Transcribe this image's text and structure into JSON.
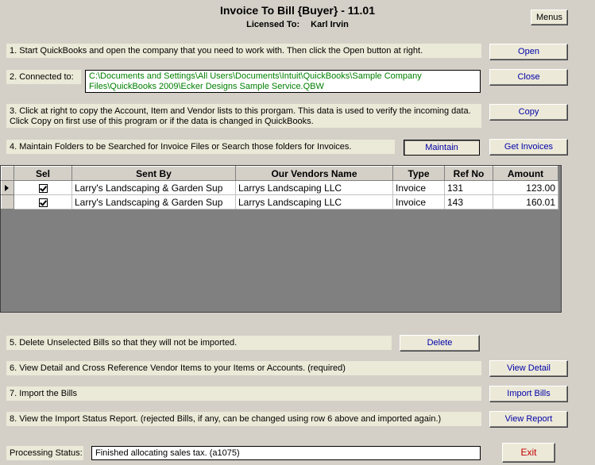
{
  "header": {
    "title": "Invoice To Bill {Buyer} - 11.01",
    "licensed_label": "Licensed To:",
    "licensed_name": "Karl Irvin"
  },
  "buttons": {
    "menus": "Menus",
    "open": "Open",
    "close": "Close",
    "copy": "Copy",
    "maintain": "Maintain",
    "get_invoices": "Get Invoices",
    "delete": "Delete",
    "view_detail": "View Detail",
    "import_bills": "Import Bills",
    "view_report": "View Report",
    "exit": "Exit"
  },
  "steps": {
    "s1": "1. Start QuickBooks and open the company that you need to work with. Then click the Open button at right.",
    "s2": "2. Connected to:",
    "s2_path": "C:\\Documents and Settings\\All Users\\Documents\\Intuit\\QuickBooks\\Sample Company Files\\QuickBooks 2009\\Ecker Designs Sample Service.QBW",
    "s3": "3. Click at right to copy the Account, Item and Vendor lists to this prorgam. This data is used to verify the incoming data. Click Copy on first use of this program or if the data is changed in QuickBooks.",
    "s4": "4. Maintain Folders to be Searched for Invoice Files or Search those folders for Invoices.",
    "s5": "5. Delete Unselected Bills so that they will not be imported.",
    "s6": "6. View Detail and Cross Reference Vendor Items to your Items or Accounts. (required)",
    "s7": "7. Import the Bills",
    "s8": "8. View the Import Status Report.  (rejected Bills, if any, can be changed using row 6 above and imported again.)"
  },
  "grid": {
    "columns": [
      "Sel",
      "Sent By",
      "Our Vendors Name",
      "Type",
      "Ref No",
      "Amount"
    ],
    "rows": [
      {
        "sel": true,
        "sent_by": "Larry's Landscaping & Garden Sup",
        "vendor": "Larrys Landscaping LLC",
        "type": "Invoice",
        "ref_no": "131",
        "amount": "123.00"
      },
      {
        "sel": true,
        "sent_by": "Larry's Landscaping & Garden Sup",
        "vendor": "Larrys Landscaping LLC",
        "type": "Invoice",
        "ref_no": "143",
        "amount": "160.01"
      }
    ]
  },
  "status": {
    "label": "Processing Status:",
    "value": "Finished allocating sales tax. (a1075)"
  }
}
